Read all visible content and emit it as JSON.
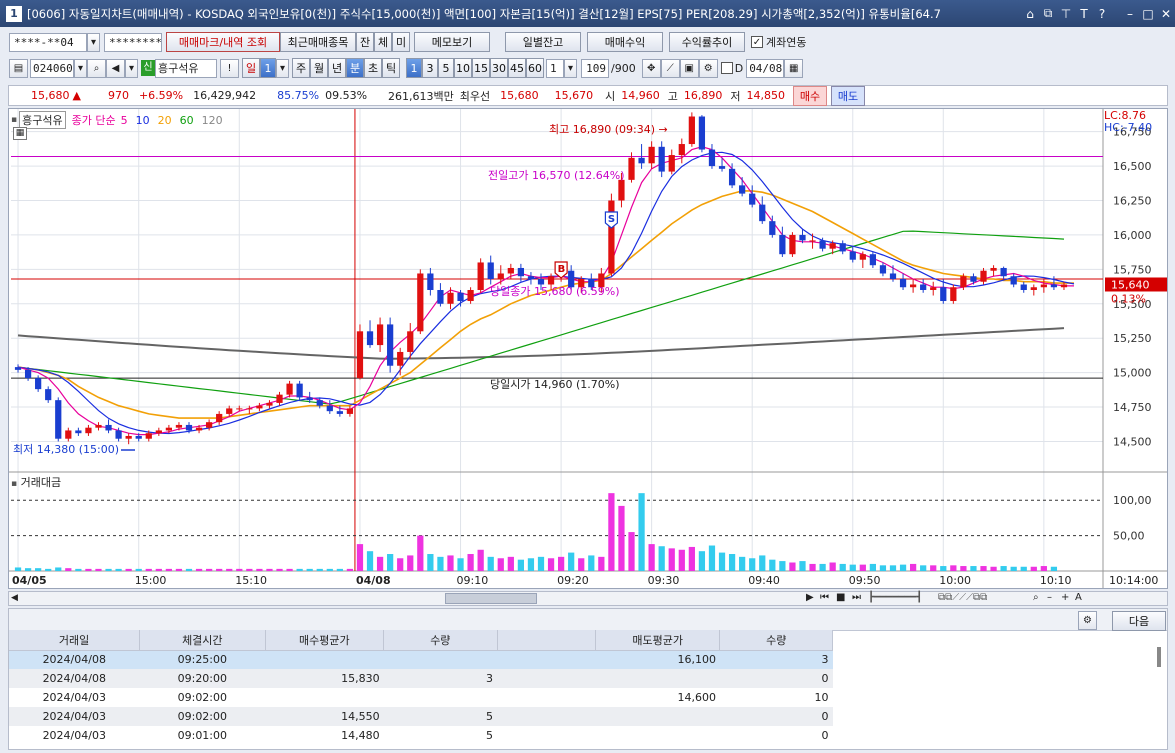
{
  "window": {
    "badge": "1",
    "title": "[0606] 자동일지차트(매매내역) - KOSDAQ 외국인보유[0(천)] 주식수[15,000(천)] 액면[100] 자본금[15(억)] 결산[12월] EPS[75] PER[208.29] 시가총액[2,352(억)] 유통비율[64.7",
    "controls": [
      "?",
      "▭",
      "⧉",
      "T",
      "T",
      "?",
      "–",
      "□",
      "✕"
    ]
  },
  "toolbar1": {
    "account": "****-**04",
    "password": "********",
    "btn_marks": "매매마크/내역 조회",
    "btn_recent": "최근매매종목",
    "btn_jan": "잔",
    "btn_che": "체",
    "btn_mi": "미",
    "btn_memo": "메모보기",
    "btn_daily": "일별잔고",
    "btn_profit": "매매수익",
    "btn_rate": "수익률추이",
    "chk_link": "계좌연동"
  },
  "toolbar2": {
    "code": "024060",
    "badge": "신",
    "name": "흥구석유",
    "period_il": "일",
    "period_il_val": "1",
    "period_ju": "주",
    "period_wol": "월",
    "period_nyeon": "년",
    "period_bun": "분",
    "period_cho": "초",
    "period_tik": "틱",
    "intervals": [
      "1",
      "3",
      "5",
      "10",
      "15",
      "30",
      "45",
      "60"
    ],
    "interval_val": "1",
    "count": "109",
    "count_max": "/900",
    "d_label": "D",
    "date": "04/08"
  },
  "quote": {
    "price": "15,680",
    "arrow": "▲",
    "change": "970",
    "pct": "+6.59%",
    "volume": "16,429,942",
    "vol_ratio": "85.75%",
    "turnover": "09.53%",
    "amount": "261,613백만",
    "best_label": "최우선",
    "best_ask": "15,680",
    "best_bid": "15,670",
    "open_label": "시",
    "open": "14,960",
    "high_label": "고",
    "high": "16,890",
    "low_label": "저",
    "low": "14,850",
    "buy": "매수",
    "sell": "매도"
  },
  "chart": {
    "legend_name": "흥구석유",
    "legend_ma": "종가 단순",
    "ma_periods": [
      "5",
      "10",
      "20",
      "60",
      "120"
    ],
    "ma_colors": [
      "#e8009b",
      "#1a2ee0",
      "#f2a007",
      "#10a010",
      "#646464"
    ],
    "lc": "LC:8.76",
    "hc": "HC:-7.40",
    "price_ticks": [
      "16,750",
      "16,500",
      "16,250",
      "16,000",
      "15,750",
      "15,500",
      "15,250",
      "15,000",
      "14,750",
      "14,500"
    ],
    "current_price_tag": "15,640",
    "current_pct": "0.13%",
    "high_note": "최고 16,890 (09:34)",
    "low_note": "최저 14,380 (15:00)",
    "prev_high_note": "전일고가 16,570 (12.64%)",
    "prev_close_note": "당일종가 15,680 (6.59%)",
    "open_note": "당일시가 14,960 (1.70%)",
    "vol_title": "거래대금",
    "vol_ticks": [
      "100,00",
      "50,00"
    ],
    "time_labels": [
      "04/05",
      "15:00",
      "15:10",
      "04/08",
      "09:10",
      "09:20",
      "09:30",
      "09:40",
      "09:50",
      "10:00",
      "10:10",
      "10:14:00"
    ],
    "marker_s": "S",
    "marker_b": "B"
  },
  "chart_data": {
    "type": "candlestick",
    "ylim": [
      14300,
      16900
    ],
    "candles": [
      [
        15040,
        15060,
        15000,
        15020
      ],
      [
        15020,
        15040,
        14940,
        14960
      ],
      [
        14960,
        14980,
        14860,
        14880
      ],
      [
        14880,
        14900,
        14780,
        14800
      ],
      [
        14800,
        14820,
        14500,
        14520
      ],
      [
        14520,
        14600,
        14500,
        14580
      ],
      [
        14580,
        14600,
        14540,
        14560
      ],
      [
        14560,
        14620,
        14540,
        14600
      ],
      [
        14600,
        14640,
        14580,
        14620
      ],
      [
        14620,
        14660,
        14560,
        14580
      ],
      [
        14580,
        14600,
        14500,
        14520
      ],
      [
        14520,
        14560,
        14480,
        14540
      ],
      [
        14540,
        14560,
        14500,
        14520
      ],
      [
        14520,
        14580,
        14500,
        14560
      ],
      [
        14560,
        14600,
        14540,
        14580
      ],
      [
        14580,
        14620,
        14560,
        14600
      ],
      [
        14600,
        14640,
        14580,
        14620
      ],
      [
        14620,
        14640,
        14560,
        14580
      ],
      [
        14580,
        14620,
        14560,
        14600
      ],
      [
        14600,
        14660,
        14580,
        14640
      ],
      [
        14640,
        14720,
        14620,
        14700
      ],
      [
        14700,
        14760,
        14680,
        14740
      ],
      [
        14740,
        14760,
        14720,
        14740
      ],
      [
        14740,
        14760,
        14700,
        14740
      ],
      [
        14740,
        14780,
        14720,
        14760
      ],
      [
        14760,
        14800,
        14740,
        14780
      ],
      [
        14780,
        14860,
        14760,
        14840
      ],
      [
        14840,
        14940,
        14820,
        14920
      ],
      [
        14920,
        14940,
        14800,
        14820
      ],
      [
        14820,
        14860,
        14780,
        14800
      ],
      [
        14800,
        14820,
        14740,
        14760
      ],
      [
        14760,
        14800,
        14700,
        14720
      ],
      [
        14720,
        14760,
        14680,
        14700
      ],
      [
        14700,
        14760,
        14680,
        14740
      ],
      [
        14960,
        15350,
        14950,
        15300
      ],
      [
        15300,
        15380,
        15180,
        15200
      ],
      [
        15200,
        15400,
        15150,
        15350
      ],
      [
        15350,
        15400,
        15000,
        15050
      ],
      [
        15050,
        15180,
        14980,
        15150
      ],
      [
        15150,
        15360,
        15100,
        15300
      ],
      [
        15300,
        15750,
        15280,
        15720
      ],
      [
        15720,
        15760,
        15560,
        15600
      ],
      [
        15600,
        15650,
        15480,
        15500
      ],
      [
        15500,
        15620,
        15460,
        15580
      ],
      [
        15580,
        15600,
        15480,
        15520
      ],
      [
        15520,
        15620,
        15500,
        15600
      ],
      [
        15600,
        15830,
        15580,
        15800
      ],
      [
        15800,
        15850,
        15640,
        15680
      ],
      [
        15680,
        15780,
        15640,
        15720
      ],
      [
        15720,
        15790,
        15680,
        15760
      ],
      [
        15760,
        15790,
        15660,
        15700
      ],
      [
        15700,
        15730,
        15640,
        15680
      ],
      [
        15680,
        15720,
        15600,
        15640
      ],
      [
        15640,
        15720,
        15600,
        15700
      ],
      [
        15700,
        15790,
        15660,
        15740
      ],
      [
        15740,
        15780,
        15600,
        15620
      ],
      [
        15620,
        15700,
        15580,
        15680
      ],
      [
        15680,
        15720,
        15600,
        15620
      ],
      [
        15620,
        15760,
        15580,
        15720
      ],
      [
        15720,
        16300,
        15700,
        16250
      ],
      [
        16250,
        16450,
        16200,
        16400
      ],
      [
        16400,
        16600,
        16380,
        16560
      ],
      [
        16560,
        16660,
        16480,
        16520
      ],
      [
        16520,
        16680,
        16480,
        16640
      ],
      [
        16640,
        16680,
        16420,
        16460
      ],
      [
        16460,
        16620,
        16440,
        16580
      ],
      [
        16580,
        16700,
        16520,
        16660
      ],
      [
        16660,
        16890,
        16640,
        16860
      ],
      [
        16860,
        16870,
        16600,
        16620
      ],
      [
        16620,
        16660,
        16480,
        16500
      ],
      [
        16500,
        16560,
        16460,
        16480
      ],
      [
        16480,
        16520,
        16340,
        16360
      ],
      [
        16360,
        16420,
        16280,
        16300
      ],
      [
        16300,
        16360,
        16200,
        16220
      ],
      [
        16220,
        16280,
        16080,
        16100
      ],
      [
        16100,
        16140,
        15980,
        16000
      ],
      [
        16000,
        16060,
        15840,
        15860
      ],
      [
        15860,
        16020,
        15840,
        16000
      ],
      [
        16000,
        16040,
        15940,
        15960
      ],
      [
        15960,
        16010,
        15900,
        15960
      ],
      [
        15960,
        15980,
        15880,
        15900
      ],
      [
        15900,
        15960,
        15860,
        15940
      ],
      [
        15940,
        15960,
        15860,
        15880
      ],
      [
        15880,
        15920,
        15800,
        15820
      ],
      [
        15820,
        15880,
        15760,
        15860
      ],
      [
        15860,
        15880,
        15760,
        15780
      ],
      [
        15780,
        15800,
        15700,
        15720
      ],
      [
        15720,
        15780,
        15660,
        15680
      ],
      [
        15680,
        15720,
        15600,
        15620
      ],
      [
        15620,
        15680,
        15580,
        15640
      ],
      [
        15640,
        15680,
        15580,
        15600
      ],
      [
        15600,
        15660,
        15560,
        15620
      ],
      [
        15620,
        15680,
        15500,
        15520
      ],
      [
        15520,
        15640,
        15500,
        15620
      ],
      [
        15620,
        15720,
        15600,
        15700
      ],
      [
        15700,
        15720,
        15640,
        15660
      ],
      [
        15660,
        15760,
        15640,
        15740
      ],
      [
        15740,
        15780,
        15700,
        15760
      ],
      [
        15760,
        15770,
        15680,
        15700
      ],
      [
        15700,
        15720,
        15620,
        15640
      ],
      [
        15640,
        15660,
        15580,
        15600
      ],
      [
        15600,
        15640,
        15560,
        15620
      ],
      [
        15620,
        15680,
        15580,
        15640
      ],
      [
        15640,
        15700,
        15600,
        15620
      ],
      [
        15620,
        15660,
        15600,
        15640
      ]
    ],
    "volume": [
      5,
      4,
      4,
      3,
      5,
      4,
      3,
      3,
      3,
      3,
      3,
      3,
      3,
      3,
      3,
      3,
      3,
      3,
      3,
      3,
      3,
      3,
      3,
      3,
      3,
      3,
      3,
      3,
      3,
      3,
      3,
      3,
      3,
      3,
      38,
      28,
      20,
      24,
      18,
      22,
      50,
      24,
      20,
      22,
      18,
      24,
      30,
      20,
      18,
      20,
      16,
      18,
      20,
      18,
      20,
      26,
      18,
      22,
      20,
      110,
      92,
      55,
      110,
      38,
      35,
      32,
      30,
      34,
      28,
      36,
      26,
      24,
      20,
      18,
      22,
      16,
      14,
      12,
      14,
      10,
      10,
      12,
      10,
      9,
      9,
      10,
      8,
      8,
      9,
      10,
      8,
      8,
      7,
      8,
      7,
      7,
      7,
      6,
      7,
      6,
      6,
      6,
      7,
      6
    ],
    "ma": {
      "5": [
        15040,
        15020,
        15000,
        14960,
        14880,
        14780,
        14700,
        14650,
        14610,
        14600,
        14580,
        14560,
        14550,
        14550,
        14560,
        14570,
        14590,
        14600,
        14610,
        14620,
        14650,
        14680,
        14720,
        14740,
        14760,
        14780,
        14800,
        14830,
        14830,
        14820,
        14800,
        14770,
        14740,
        14730,
        14780,
        14900,
        15050,
        15150,
        15220,
        15280,
        15350,
        15450,
        15550,
        15600,
        15580,
        15560,
        15580,
        15620,
        15660,
        15700,
        15720,
        15700,
        15690,
        15690,
        15700,
        15680,
        15660,
        15660,
        15680,
        15800,
        16000,
        16200,
        16380,
        16480,
        16520,
        16540,
        16560,
        16620,
        16640,
        16620,
        16560,
        16480,
        16400,
        16300,
        16200,
        16100,
        16000,
        15960,
        15950,
        15950,
        15940,
        15920,
        15900,
        15880,
        15860,
        15830,
        15800,
        15760,
        15720,
        15680,
        15650,
        15620,
        15620,
        15610,
        15620,
        15650,
        15680,
        15700,
        15710,
        15720,
        15700,
        15670,
        15650,
        15640,
        15630,
        15630
      ],
      "20": [
        15040,
        15030,
        15020,
        15000,
        14980,
        14950,
        14900,
        14860,
        14820,
        14790,
        14760,
        14740,
        14720,
        14700,
        14690,
        14680,
        14670,
        14670,
        14670,
        14670,
        14670,
        14680,
        14690,
        14700,
        14710,
        14720,
        14730,
        14740,
        14750,
        14760,
        14760,
        14760,
        14760,
        14760,
        14800,
        14840,
        14880,
        14920,
        14960,
        15000,
        15060,
        15120,
        15180,
        15240,
        15300,
        15350,
        15390,
        15420,
        15460,
        15500,
        15530,
        15560,
        15580,
        15600,
        15620,
        15640,
        15650,
        15660,
        15670,
        15720,
        15780,
        15840,
        15900,
        15960,
        16020,
        16080,
        16130,
        16180,
        16220,
        16250,
        16280,
        16300,
        16320,
        16320,
        16310,
        16290,
        16260,
        16230,
        16200,
        16170,
        16130,
        16090,
        16050,
        16010,
        15970,
        15930,
        15890,
        15850,
        15810,
        15780,
        15760,
        15740,
        15720,
        15710,
        15700,
        15690,
        15680,
        15680,
        15670,
        15670,
        15660,
        15660,
        15660,
        15650,
        15650,
        15650
      ]
    }
  },
  "scroll": {
    "bottom_icons": [
      "▶",
      "⏮",
      "■",
      "⏭",
      "A"
    ]
  },
  "table": {
    "next_btn": "다음",
    "headers": [
      "거래일",
      "체결시간",
      "매수평균가",
      "수량",
      "",
      "매도평균가",
      "수량"
    ],
    "rows": [
      [
        "2024/04/08",
        "09:25:00",
        "",
        "",
        "",
        "16,100",
        "3"
      ],
      [
        "2024/04/08",
        "09:20:00",
        "15,830",
        "3",
        "",
        "",
        "0"
      ],
      [
        "2024/04/03",
        "09:02:00",
        "",
        "",
        "",
        "14,600",
        "10"
      ],
      [
        "2024/04/03",
        "09:02:00",
        "14,550",
        "5",
        "",
        "",
        "0"
      ],
      [
        "2024/04/03",
        "09:01:00",
        "14,480",
        "5",
        "",
        "",
        "0"
      ]
    ]
  }
}
